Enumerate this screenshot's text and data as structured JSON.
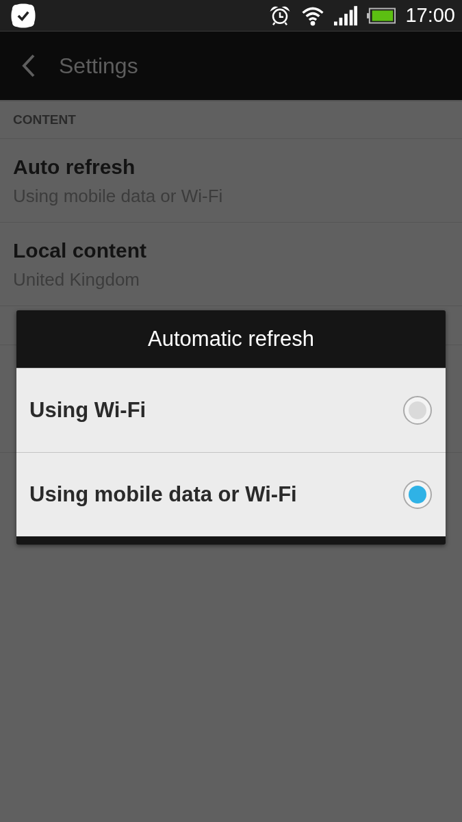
{
  "status_bar": {
    "time": "17:00"
  },
  "app_bar": {
    "title": "Settings"
  },
  "section": {
    "header": "CONTENT"
  },
  "settings": [
    {
      "title": "Auto refresh",
      "summary": "Using mobile data or Wi-Fi"
    },
    {
      "title": "Local content",
      "summary": "United Kingdom"
    }
  ],
  "dialog": {
    "title": "Automatic refresh",
    "options": [
      {
        "label": "Using Wi-Fi",
        "selected": false
      },
      {
        "label": "Using mobile data or Wi-Fi",
        "selected": true
      }
    ]
  }
}
